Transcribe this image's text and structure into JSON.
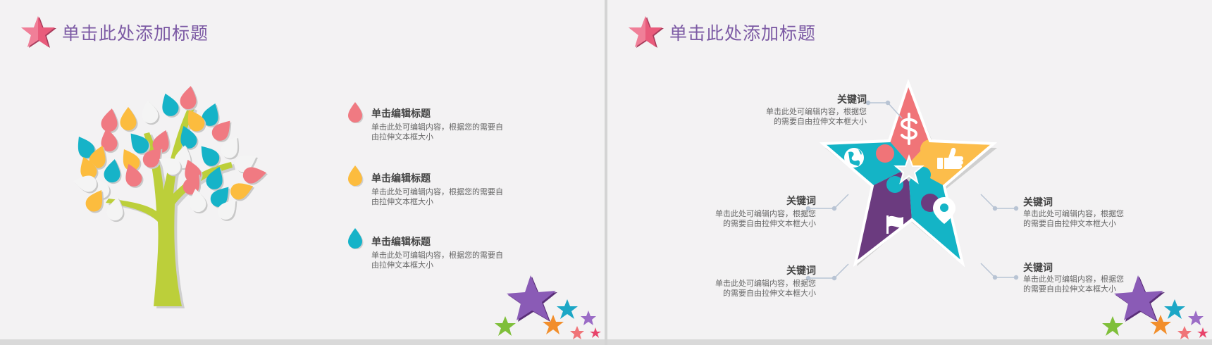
{
  "slide1": {
    "title": "单击此处添加标题",
    "items": [
      {
        "title": "单击编辑标题",
        "text_line1": "单击此处可编辑内容，根据您的需要自",
        "text_line2": "由拉伸文本框大小",
        "color": "#f07a82"
      },
      {
        "title": "单击编辑标题",
        "text_line1": "单击此处可编辑内容，根据您的需要自",
        "text_line2": "由拉伸文本框大小",
        "color": "#fcbc3e"
      },
      {
        "title": "单击编辑标题",
        "text_line1": "单击此处可编辑内容，根据您的需要自",
        "text_line2": "由拉伸文本框大小",
        "color": "#16b3c8"
      }
    ]
  },
  "slide2": {
    "title": "单击此处添加标题",
    "keywords": [
      {
        "title": "关键词",
        "text_line1": "单击此处可编辑内容，根据您",
        "text_line2": "的需要自由拉伸文本框大小"
      },
      {
        "title": "关键词",
        "text_line1": "单击此处可编辑内容，根据您",
        "text_line2": "的需要自由拉伸文本框大小"
      },
      {
        "title": "关键词",
        "text_line1": "单击此处可编辑内容，根据您",
        "text_line2": "的需要自由拉伸文本框大小"
      },
      {
        "title": "关键词",
        "text_line1": "单击此处可编辑内容，根据您",
        "text_line2": "的需要自由拉伸文本框大小"
      },
      {
        "title": "关键词",
        "text_line1": "单击此处可编辑内容，根据您",
        "text_line2": "的需要自由拉伸文本框大小"
      }
    ],
    "pieces": [
      {
        "name": "top",
        "color": "#f07478",
        "icon": "dollar-icon"
      },
      {
        "name": "right",
        "color": "#fcbd4b",
        "icon": "thumbs-up-icon"
      },
      {
        "name": "left",
        "color": "#14b4c6",
        "icon": "globe-icon"
      },
      {
        "name": "bottom-left",
        "color": "#6b3b7f",
        "icon": "flag-icon"
      },
      {
        "name": "bottom-right",
        "color": "#14b4c6",
        "icon": "location-pin-icon"
      }
    ]
  },
  "colors": {
    "title": "#7c5aa4",
    "tree_trunk": "#bccf3a",
    "logo_star": "#e95b7b"
  }
}
